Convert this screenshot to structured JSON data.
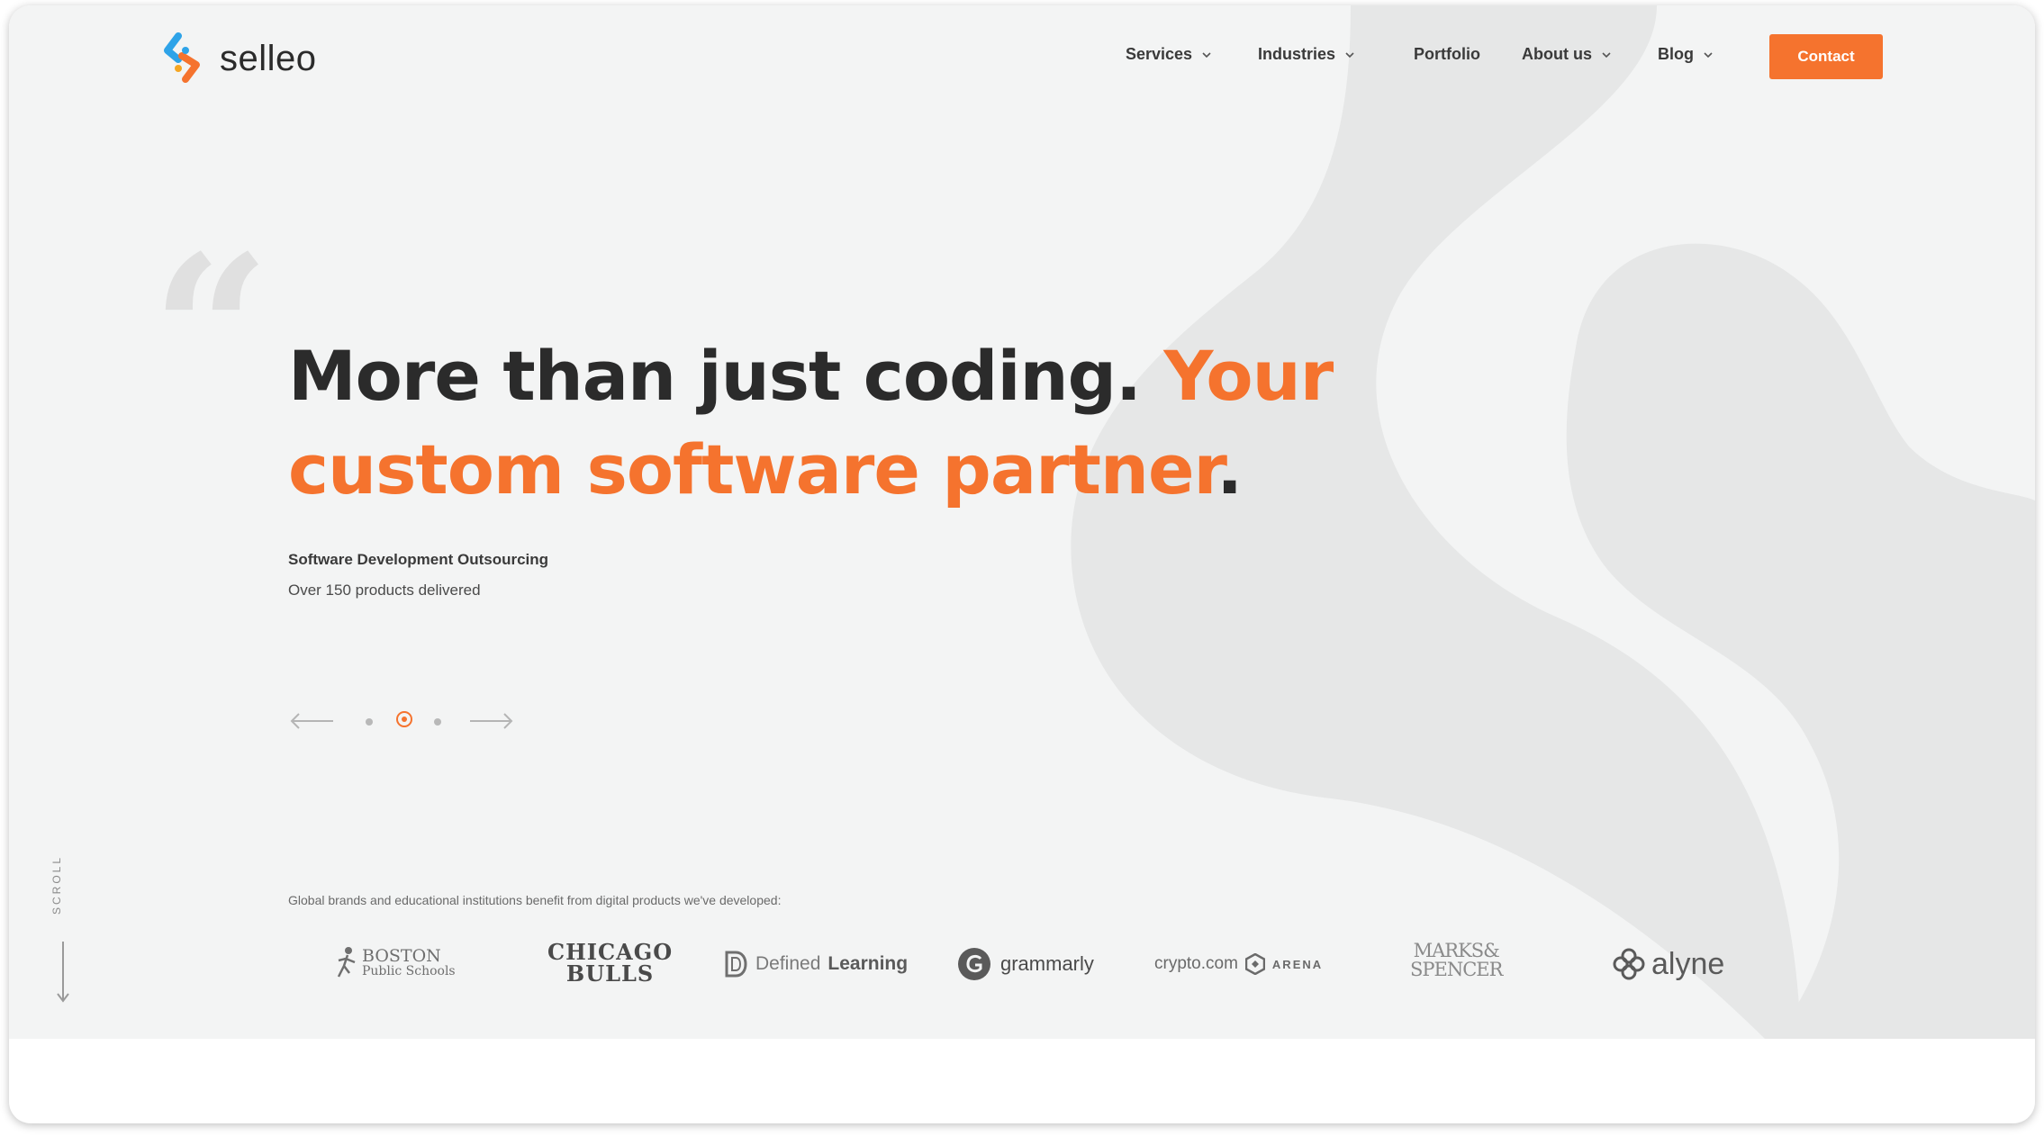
{
  "header": {
    "logo_text": "selleo",
    "nav": [
      {
        "label": "Services",
        "has_dropdown": true
      },
      {
        "label": "Industries",
        "has_dropdown": true
      },
      {
        "label": "Portfolio",
        "has_dropdown": false
      },
      {
        "label": "About us",
        "has_dropdown": true
      },
      {
        "label": "Blog",
        "has_dropdown": true
      }
    ],
    "contact_label": "Contact"
  },
  "hero": {
    "headline_dark": "More than just coding. ",
    "headline_accent": "Your custom software partner",
    "headline_period": ".",
    "subtitle": "Software Development Outsourcing",
    "detail": "Over 150 products delivered",
    "carousel": {
      "slides": 3,
      "active_index": 1
    }
  },
  "scroll_label": "SCROLL",
  "brands": {
    "caption": "Global brands and educational institutions benefit from digital products we've developed:",
    "boston_line1": "BOSTON",
    "boston_line2": "Public Schools",
    "chicago_line1": "CHICAGO",
    "chicago_line2": "BULLS",
    "defined_a": "Defined",
    "defined_b": "Learning",
    "grammarly": "grammarly",
    "crypto_a": "crypto.com",
    "crypto_b": "ARENA",
    "marks_line1": "MARKS&",
    "marks_line2": "SPENCER",
    "alyne": "alyne"
  },
  "colors": {
    "accent": "#f5732e",
    "text_dark": "#2b2b2b",
    "background": "#f3f4f4",
    "shape": "#e6e7e7"
  },
  "icons": [
    "selleo-logo-icon",
    "chevron-down-icon",
    "arrow-left-icon",
    "arrow-right-icon",
    "scroll-down-arrow-icon"
  ]
}
